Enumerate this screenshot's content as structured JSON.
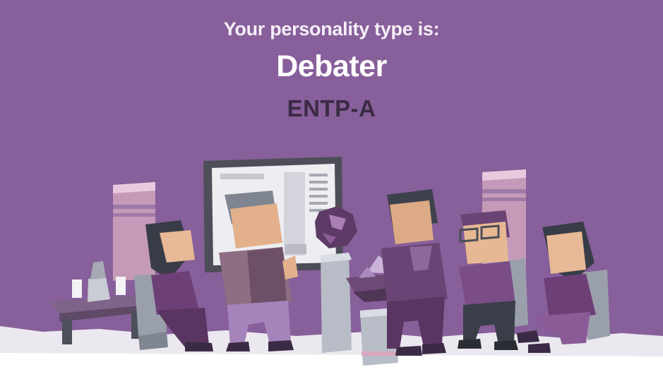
{
  "result": {
    "lead_text": "Your personality type is:",
    "type_name": "Debater",
    "type_code": "ENTP-A"
  },
  "illustration": {
    "subject": "group-discussion-scene",
    "characters": [
      "woman-seated-left",
      "presenter-man",
      "man-thinking",
      "man-with-glasses",
      "woman-seated-right"
    ]
  },
  "colors": {
    "background": "#875f9a",
    "heading": "#ffffff",
    "code": "#3b2a45",
    "floor": "#ebe8ef"
  }
}
